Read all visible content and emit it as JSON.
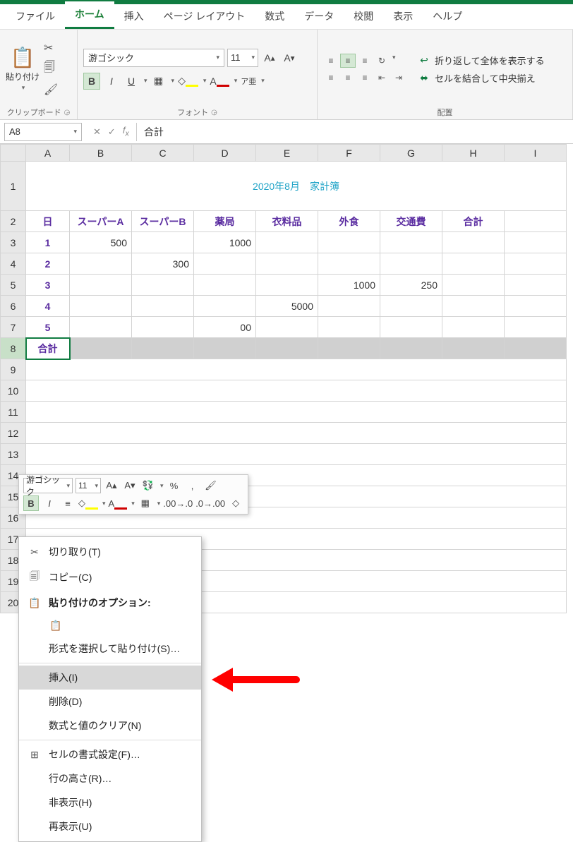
{
  "tabs": {
    "file": "ファイル",
    "home": "ホーム",
    "insert": "挿入",
    "pagelayout": "ページ レイアウト",
    "formulas": "数式",
    "data": "データ",
    "review": "校閲",
    "view": "表示",
    "help": "ヘルプ"
  },
  "ribbon": {
    "clipboard": {
      "label": "クリップボード",
      "paste": "貼り付け"
    },
    "font": {
      "label": "フォント",
      "name": "游ゴシック",
      "size": "11",
      "bold": "B",
      "italic": "I",
      "underline": "U",
      "ruby": "ア亜"
    },
    "alignment": {
      "label": "配置",
      "wrap": "折り返して全体を表示する",
      "merge": "セルを結合して中央揃え"
    }
  },
  "namebox": "A8",
  "fx_value": "合計",
  "columns": [
    "A",
    "B",
    "C",
    "D",
    "E",
    "F",
    "G",
    "H",
    "I"
  ],
  "title": "2020年8月　家計簿",
  "headers": {
    "day": "日",
    "sa": "スーパーA",
    "sb": "スーパーB",
    "ph": "薬局",
    "cl": "衣料品",
    "eat": "外食",
    "tr": "交通費",
    "tot": "合計"
  },
  "rows": {
    "r3": {
      "day": "1",
      "B": "500",
      "D": "1000"
    },
    "r4": {
      "day": "2",
      "C": "300"
    },
    "r5": {
      "day": "3",
      "F": "1000",
      "G": "250"
    },
    "r6": {
      "day": "4",
      "E": "5000"
    },
    "r7": {
      "day": "5",
      "D_partial": "00"
    },
    "r8": {
      "A": "合計"
    }
  },
  "mini": {
    "font": "游ゴシック",
    "size": "11",
    "pct": "%",
    "comma": ","
  },
  "ctx": {
    "cut": "切り取り(T)",
    "copy": "コピー(C)",
    "paste_opts": "貼り付けのオプション:",
    "paste_special": "形式を選択して貼り付け(S)…",
    "insert": "挿入(I)",
    "delete": "削除(D)",
    "clear": "数式と値のクリア(N)",
    "format": "セルの書式設定(F)…",
    "rowheight": "行の高さ(R)…",
    "hide": "非表示(H)",
    "unhide": "再表示(U)"
  }
}
